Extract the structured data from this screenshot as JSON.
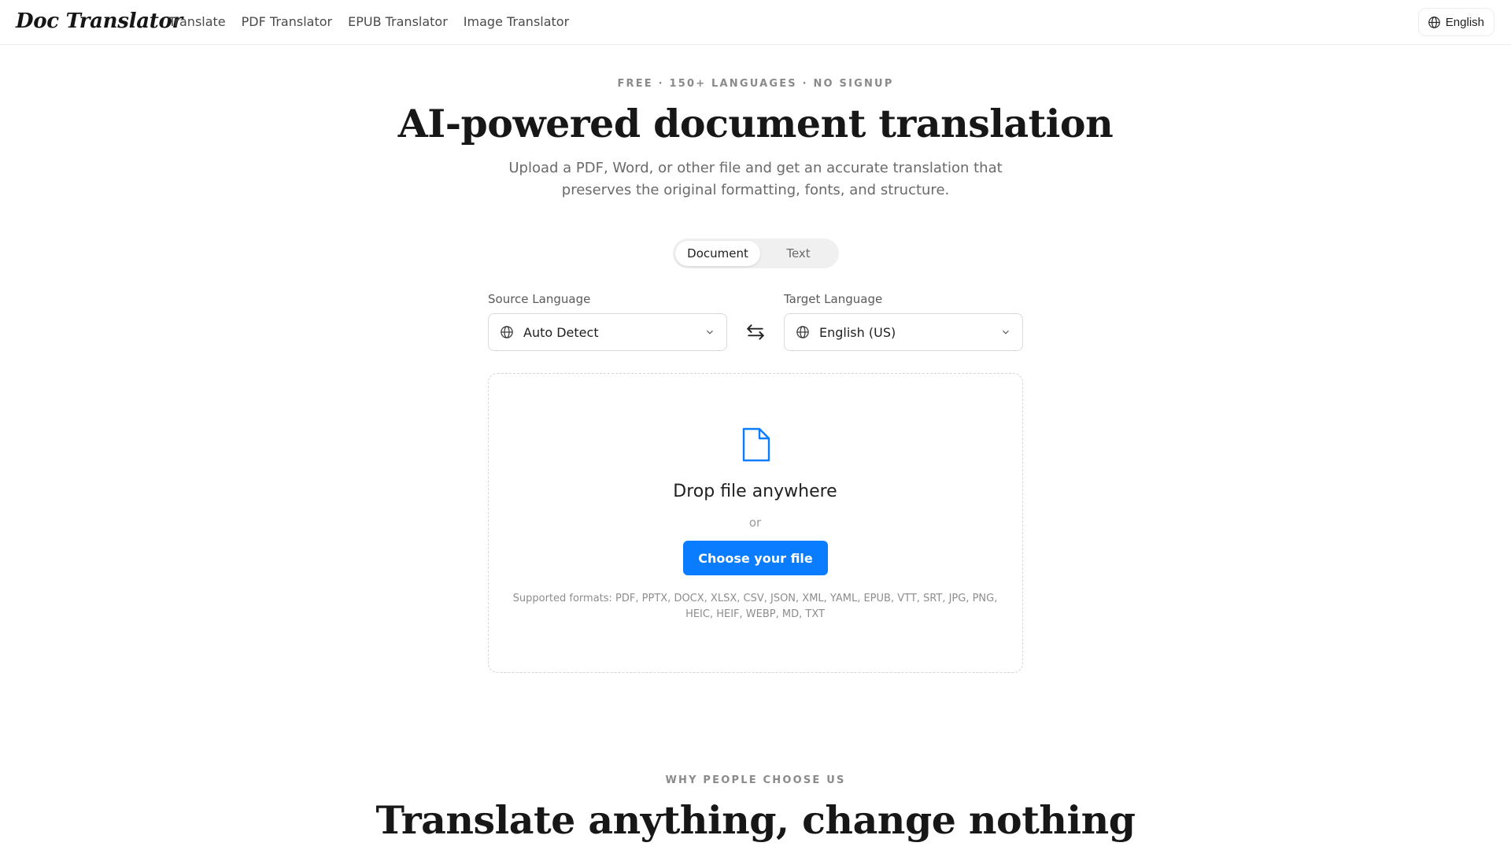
{
  "header": {
    "logo": "Doc Translator",
    "nav": [
      "Translate",
      "PDF Translator",
      "EPUB Translator",
      "Image Translator"
    ],
    "language_button": "English",
    "language_icon": "globe-icon"
  },
  "hero": {
    "eyebrow": "FREE · 150+ LANGUAGES · NO SIGNUP",
    "title": "AI-powered document translation",
    "subtitle": "Upload a PDF, Word, or other file and get an accurate translation that preserves the original formatting, fonts, and structure."
  },
  "mode_toggle": {
    "options": [
      "Document",
      "Text"
    ],
    "selected": "Document"
  },
  "languages": {
    "source_label": "Source Language",
    "source_value": "Auto Detect",
    "target_label": "Target Language",
    "target_value": "English (US)",
    "swap_icon": "swap-arrows-icon"
  },
  "upload": {
    "icon": "file-icon",
    "title": "Drop file anywhere",
    "or": "or",
    "button": "Choose your file",
    "formats": "Supported formats: PDF, PPTX, DOCX, XLSX, CSV, JSON, XML, YAML, EPUB, VTT, SRT, JPG, PNG, HEIC, HEIF, WEBP, MD, TXT"
  },
  "why": {
    "eyebrow": "WHY PEOPLE CHOOSE US",
    "title": "Translate anything, change nothing"
  },
  "colors": {
    "accent": "#0a7cff",
    "text": "#1f1f1f",
    "muted": "#6a6a6a",
    "border": "#d9d9d9"
  }
}
